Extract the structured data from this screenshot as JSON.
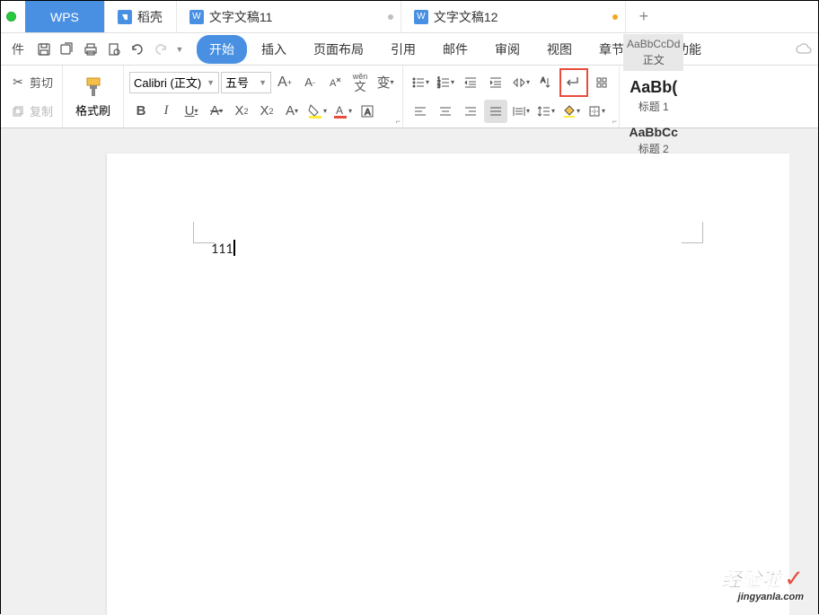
{
  "tabs": {
    "wps": "WPS",
    "daoke": "稻壳",
    "doc11": "文字文稿11",
    "doc12": "文字文稿12"
  },
  "menu": {
    "file_suffix": "件",
    "start": "开始",
    "insert": "插入",
    "layout": "页面布局",
    "reference": "引用",
    "mail": "邮件",
    "review": "审阅",
    "view": "视图",
    "chapter": "章节",
    "special": "特色功能"
  },
  "clipboard": {
    "cut": "剪切",
    "copy": "复制",
    "format_brush": "格式刷"
  },
  "font": {
    "name": "Calibri (正文)",
    "size": "五号",
    "bold": "B",
    "italic": "I",
    "underline": "U",
    "wen": "wěn",
    "bian": "变"
  },
  "styles": {
    "normal_preview": "AaBbCcDd",
    "normal_label": "正文",
    "h1_preview": "AaBb(",
    "h1_label": "标题 1",
    "h2_preview": "AaBbCc",
    "h2_label": "标题 2"
  },
  "document": {
    "text": "111"
  },
  "watermark": {
    "main": "经验啦",
    "check": "✓",
    "sub": "jingyanla.com"
  }
}
